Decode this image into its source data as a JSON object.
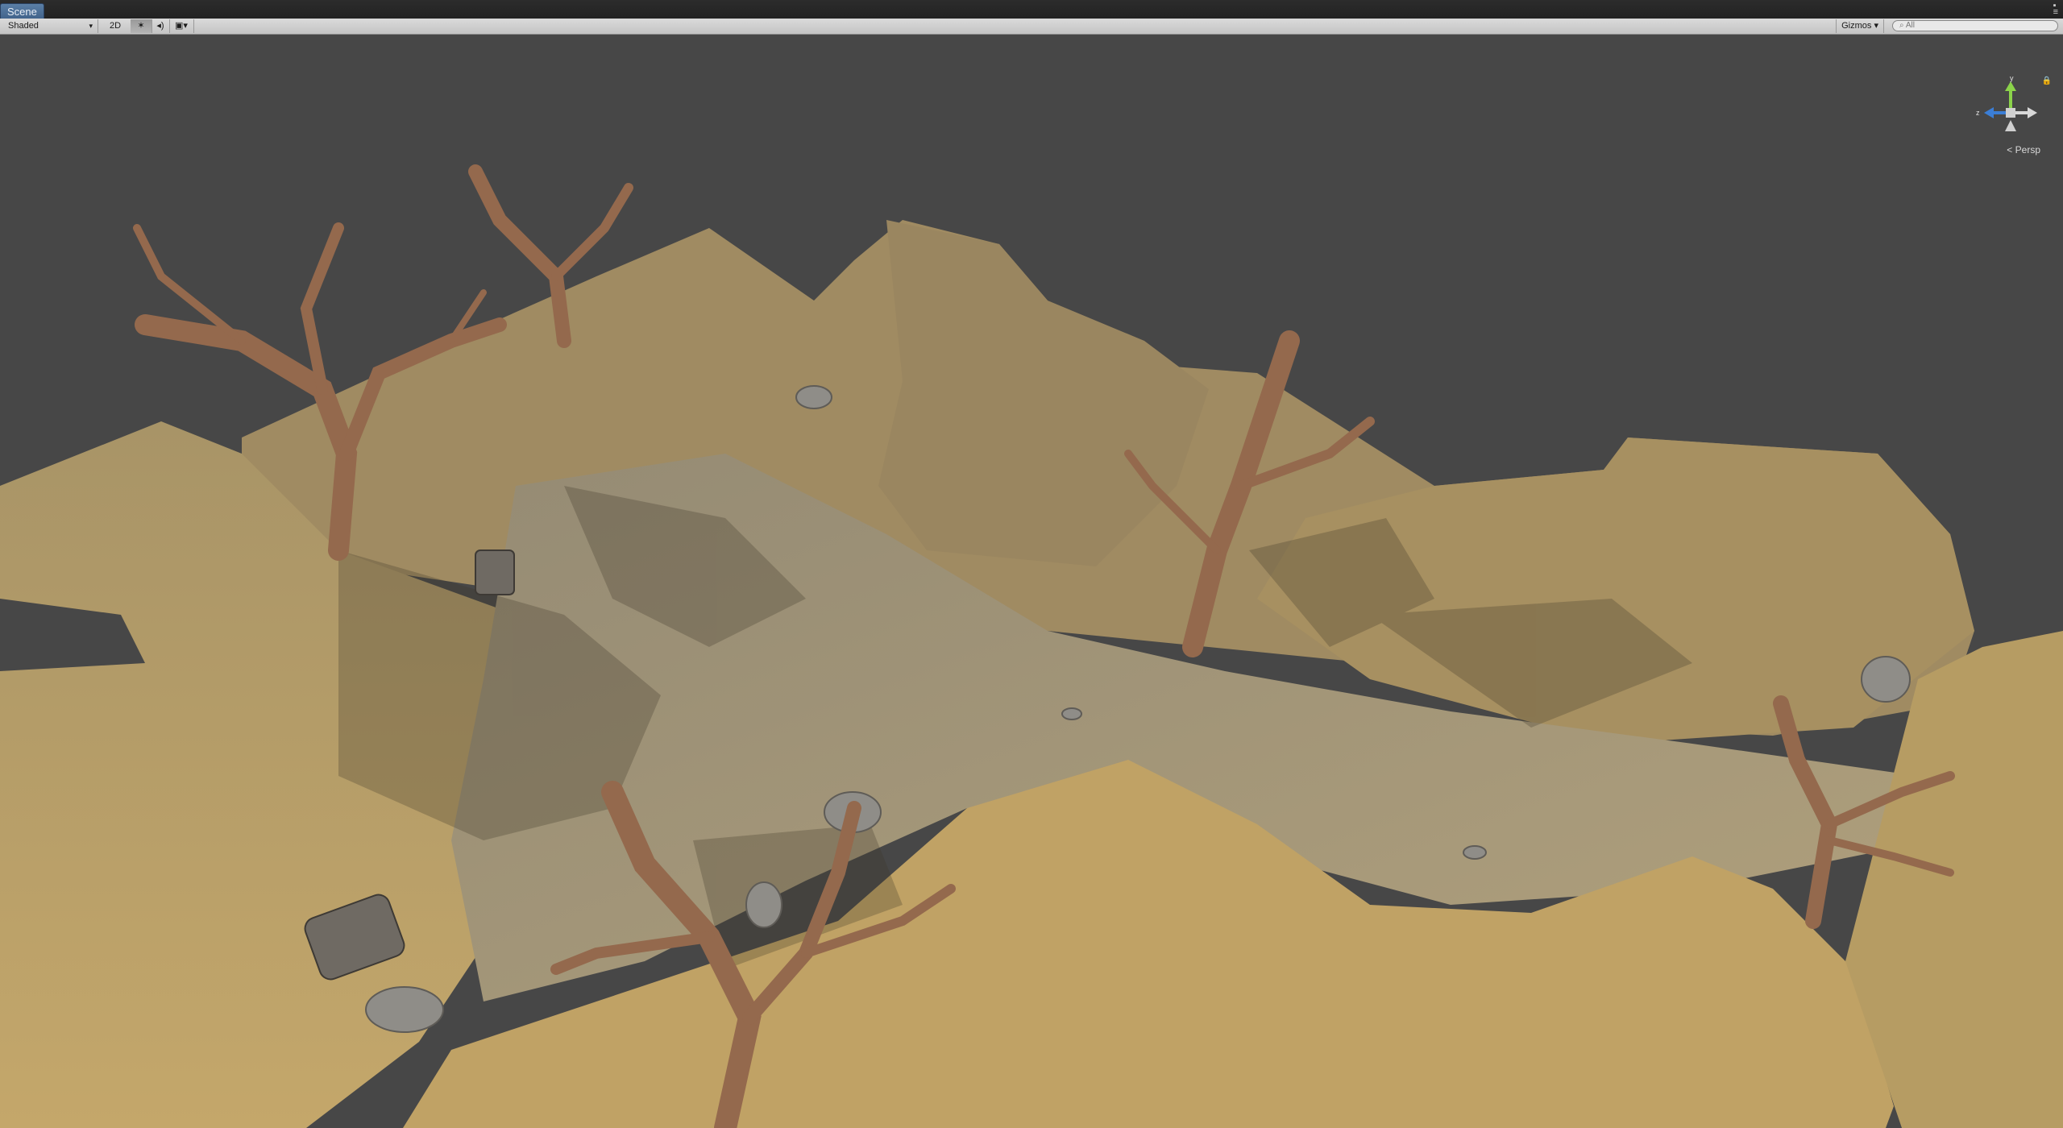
{
  "window": {
    "tab_label": "Scene"
  },
  "toolbar": {
    "draw_mode": "Shaded",
    "mode_2d": "2D",
    "lighting_icon": "sun-icon",
    "audio_icon": "speaker-icon",
    "effects_icon": "image-icon",
    "gizmos_label": "Gizmos",
    "search_placeholder": "All"
  },
  "orientation_gizmo": {
    "y_label": "y",
    "z_label": "z",
    "projection_label": "Persp"
  },
  "colors": {
    "viewport_bg": "#474747",
    "terrain": "#b39a63",
    "terrain_dark": "#8d7548",
    "path": "#a79677",
    "tree": "#9c7256",
    "rock": "#8e8e8e",
    "tab_active": "#4a6c94"
  }
}
